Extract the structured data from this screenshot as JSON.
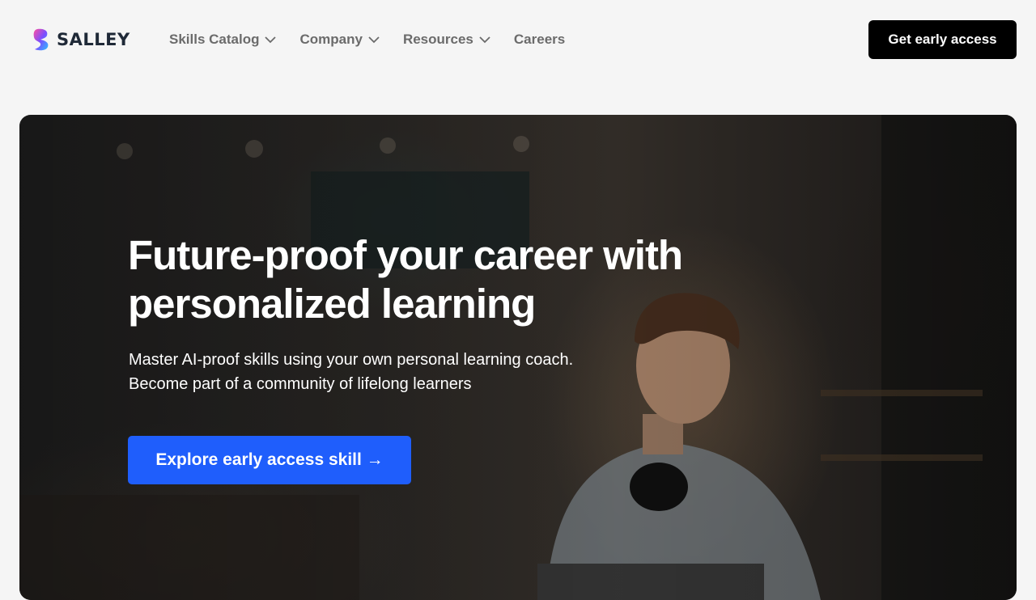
{
  "brand": {
    "name": "SALLEY",
    "logo_icon": "salley-logo-icon",
    "logo_colors": [
      "#ff4fa0",
      "#7c4dff",
      "#2bc0ff"
    ]
  },
  "nav": {
    "items": [
      {
        "label": "Skills Catalog",
        "icon": "chevron-down-icon"
      },
      {
        "label": "Company",
        "icon": "chevron-down-icon"
      },
      {
        "label": "Resources",
        "icon": "chevron-down-icon"
      },
      {
        "label": "Careers"
      }
    ],
    "cta_label": "Get early access"
  },
  "hero": {
    "title": "Future-proof your career with personalized learning",
    "subtitle_lines": [
      "Master AI-proof skills using your own personal learning coach.",
      "Become part of a community of lifelong learners"
    ],
    "cta_label": "Explore early access skill →",
    "background_image": "person-at-laptop-in-cafe-photo"
  },
  "colors": {
    "page_bg": "#f5f5f5",
    "top_cta_bg": "#000000",
    "hero_cta_bg": "#1f5efc",
    "nav_text": "#6b6b6b"
  }
}
